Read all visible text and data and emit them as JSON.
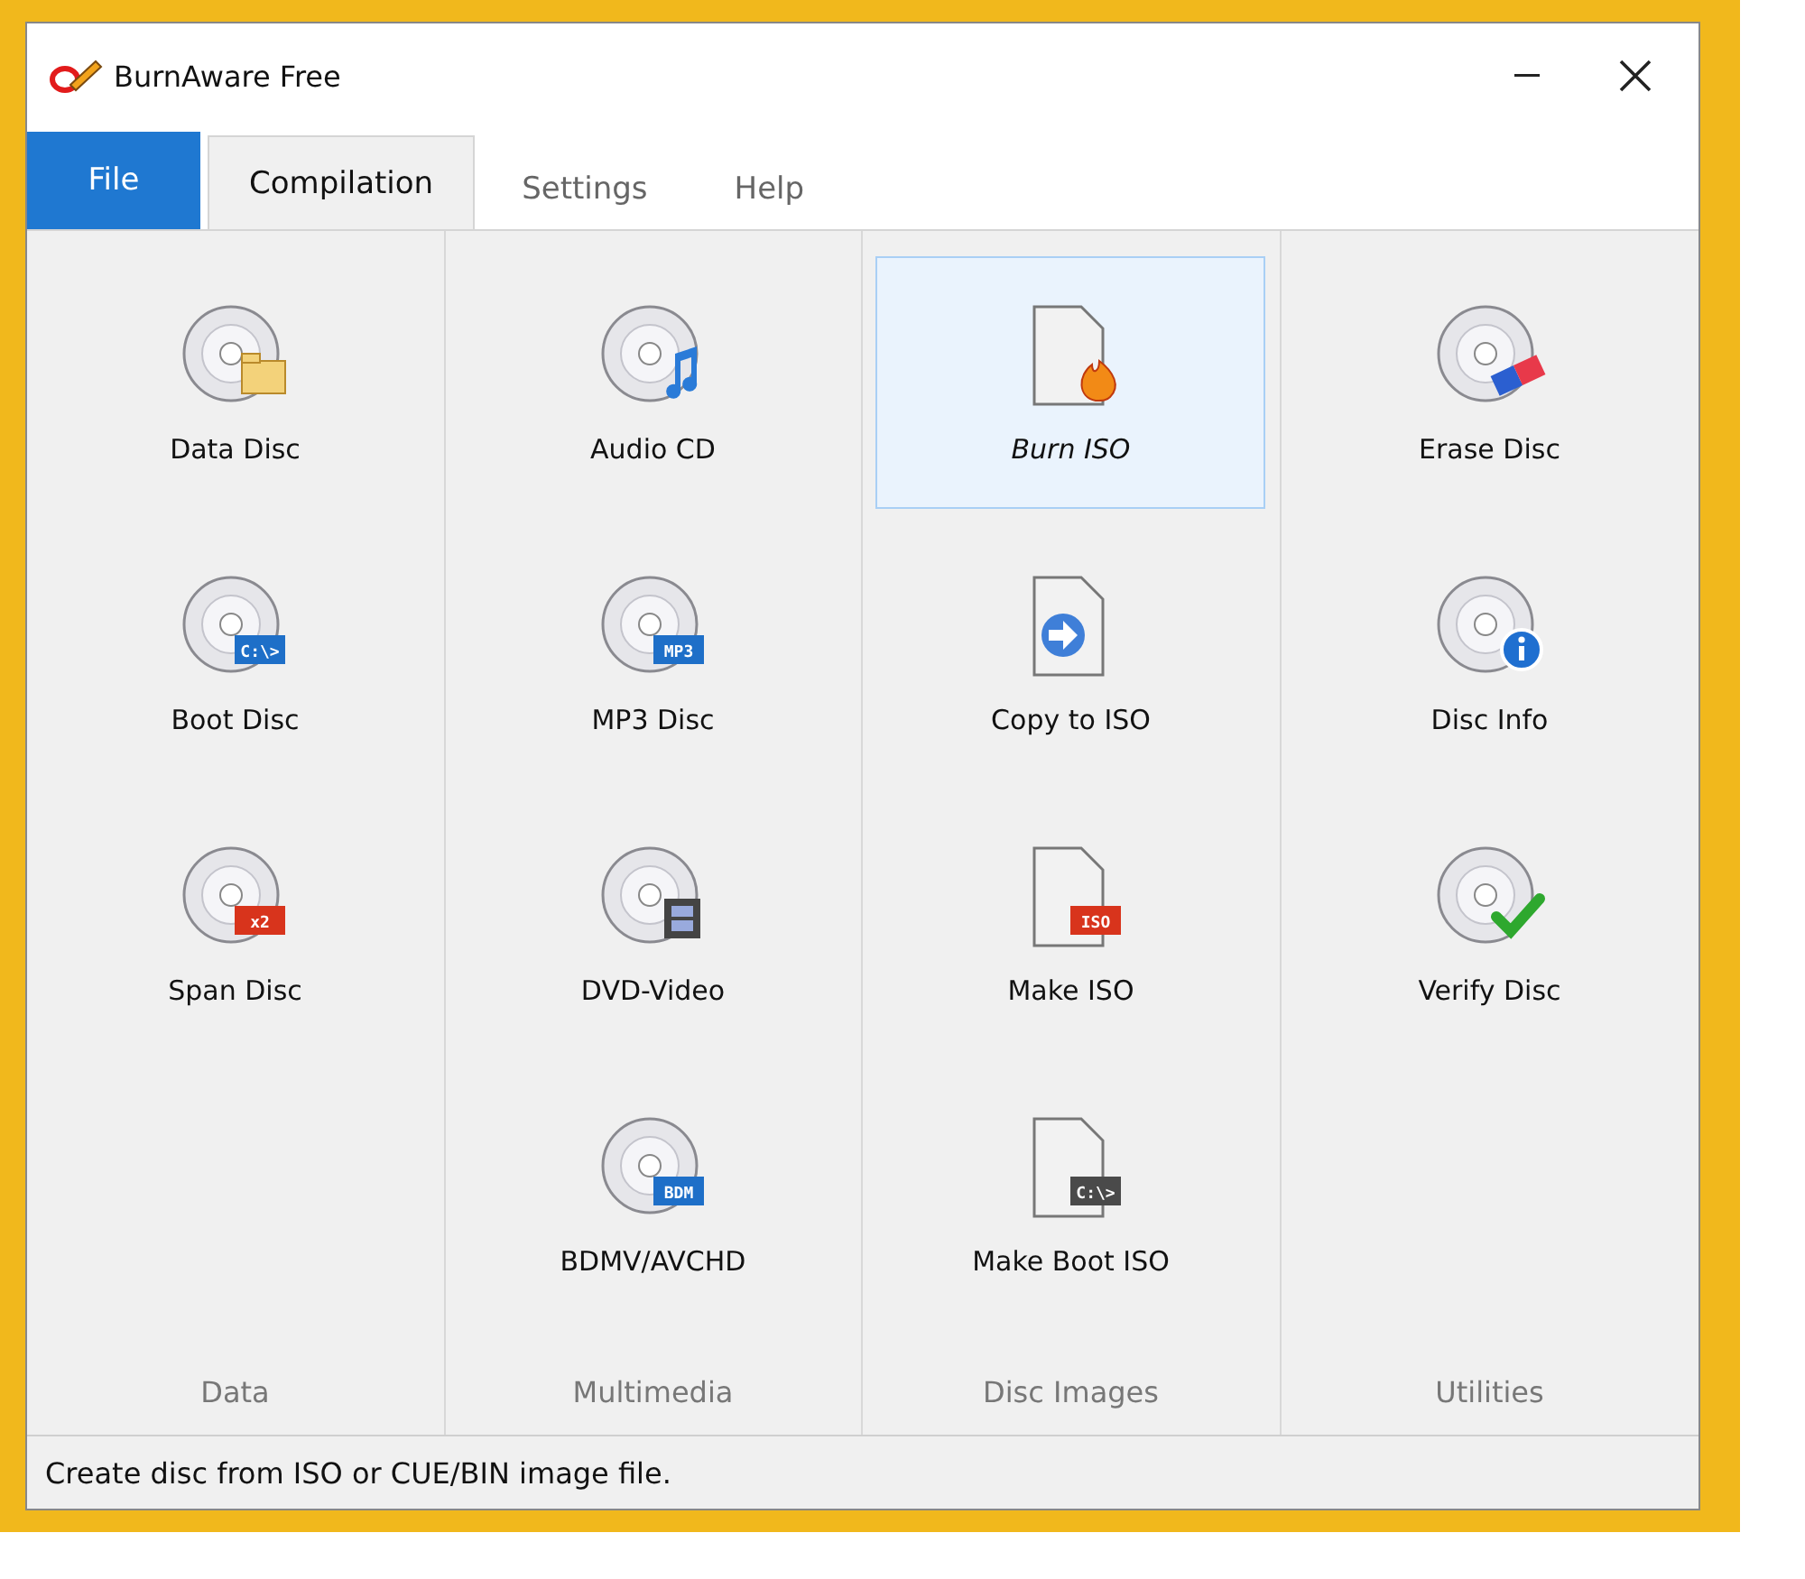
{
  "window": {
    "title": "BurnAware Free"
  },
  "tabs": [
    {
      "label": "File",
      "kind": "file",
      "selected": false
    },
    {
      "label": "Compilation",
      "kind": "tab",
      "selected": true
    },
    {
      "label": "Settings",
      "kind": "tab",
      "selected": false
    },
    {
      "label": "Help",
      "kind": "tab",
      "selected": false
    }
  ],
  "groups": [
    {
      "label": "Data",
      "items": [
        {
          "label": "Data Disc",
          "kind": "folder",
          "selected": false
        },
        {
          "label": "Boot Disc",
          "kind": "disclabel",
          "badge": "C:\\>",
          "selected": false
        },
        {
          "label": "Span Disc",
          "kind": "disclabel",
          "badge": "x2",
          "selected": false
        }
      ]
    },
    {
      "label": "Multimedia",
      "items": [
        {
          "label": "Audio CD",
          "kind": "note",
          "selected": false
        },
        {
          "label": "MP3 Disc",
          "kind": "disclabel",
          "badge": "MP3",
          "selected": false
        },
        {
          "label": "DVD-Video",
          "kind": "film",
          "selected": false
        },
        {
          "label": "BDMV/AVCHD",
          "kind": "disclabel",
          "badge": "BDM",
          "selected": false
        }
      ]
    },
    {
      "label": "Disc Images",
      "items": [
        {
          "label": "Burn ISO",
          "kind": "flame",
          "selected": true
        },
        {
          "label": "Copy to ISO",
          "kind": "arrow",
          "selected": false
        },
        {
          "label": "Make ISO",
          "kind": "doclabel",
          "badge": "ISO",
          "selected": false
        },
        {
          "label": "Make Boot ISO",
          "kind": "doclabel",
          "badge": "C:\\>",
          "selected": false
        }
      ]
    },
    {
      "label": "Utilities",
      "items": [
        {
          "label": "Erase Disc",
          "kind": "eraser",
          "selected": false
        },
        {
          "label": "Disc Info",
          "kind": "info",
          "selected": false
        },
        {
          "label": "Verify Disc",
          "kind": "check",
          "selected": false
        }
      ]
    }
  ],
  "status_bar": {
    "text": "Create disc from ISO or CUE/BIN image file."
  }
}
